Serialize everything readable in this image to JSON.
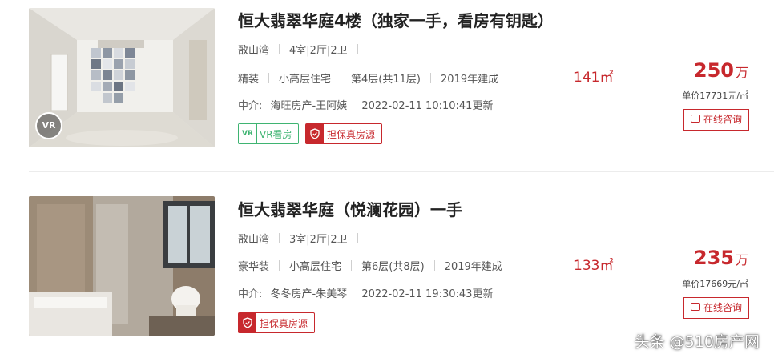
{
  "listings": [
    {
      "title": "恒大翡翠华庭4楼（独家一手，看房有钥匙）",
      "district": "敔山湾",
      "layout": "4室|2厅|2卫",
      "decoration": "精装",
      "building_type": "小高层住宅",
      "floor": "第4层(共11层)",
      "year": "2019年建成",
      "agent_label": "中介:",
      "agent": "海旺房产-王阿姨",
      "updated": "2022-02-11 10:10:41更新",
      "area": "141㎡",
      "price_value": "250",
      "price_unit": "万",
      "unit_price": "单价17731元/㎡",
      "consult_label": "在线咨询",
      "vr_badge": "VR",
      "tags": {
        "vr_label": "VR看房",
        "true_label": "担保真房源"
      }
    },
    {
      "title": "恒大翡翠华庭（悦澜花园）一手",
      "district": "敔山湾",
      "layout": "3室|2厅|2卫",
      "decoration": "豪华装",
      "building_type": "小高层住宅",
      "floor": "第6层(共8层)",
      "year": "2019年建成",
      "agent_label": "中介:",
      "agent": "冬冬房产-朱美琴",
      "updated": "2022-02-11 19:30:43更新",
      "area": "133㎡",
      "price_value": "235",
      "price_unit": "万",
      "unit_price": "单价17669元/㎡",
      "consult_label": "在线咨询",
      "tags": {
        "true_label": "担保真房源"
      }
    }
  ],
  "watermark": "头条 @510房产网",
  "colors": {
    "accent": "#c7282d",
    "vr_green": "#3fb472"
  }
}
